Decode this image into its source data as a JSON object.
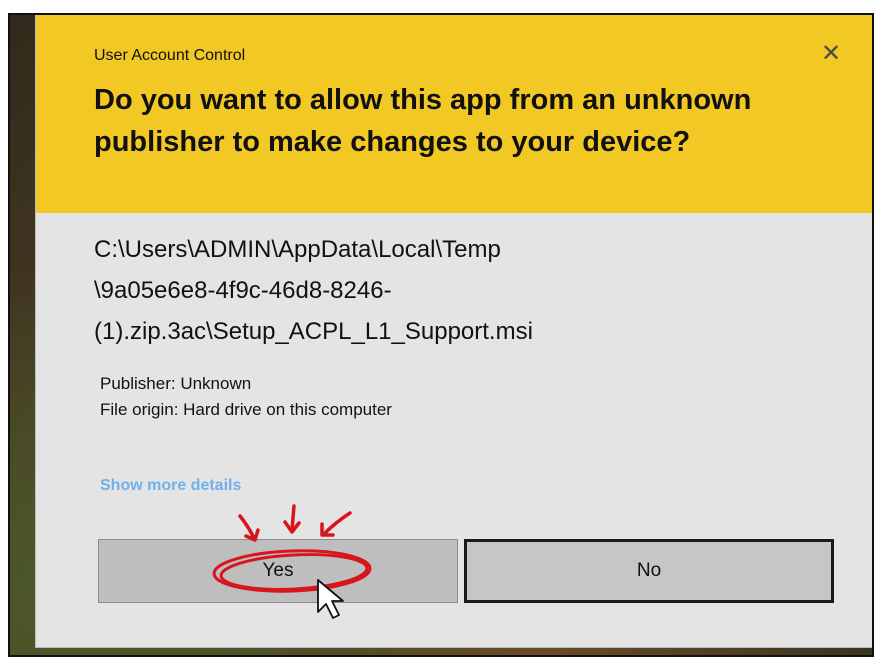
{
  "dialog": {
    "caption": "User Account Control",
    "question": "Do you want to allow this app from an unknown publisher to make changes to your device?",
    "path_lines": [
      "C:\\Users\\ADMIN\\AppData\\Local\\Temp",
      "\\9a05e6e8-4f9c-46d8-8246-",
      "(1).zip.3ac\\Setup_ACPL_L1_Support.msi"
    ],
    "publisher": "Publisher: Unknown",
    "file_origin": "File origin: Hard drive on this computer",
    "show_more_details": "Show more details",
    "yes_label": "Yes",
    "no_label": "No",
    "close_icon": "close-icon"
  },
  "colors": {
    "header_yellow": "#f2c824",
    "dialog_gray": "#e4e4e4",
    "link_blue": "#6fb1ea",
    "annotation_red": "#d8141c"
  },
  "annotations": {
    "arrows": [
      "red-arrow-icon",
      "red-arrow-icon",
      "red-arrow-icon"
    ],
    "circle": "red-circle-highlight",
    "cursor": "mouse-pointer-icon"
  }
}
